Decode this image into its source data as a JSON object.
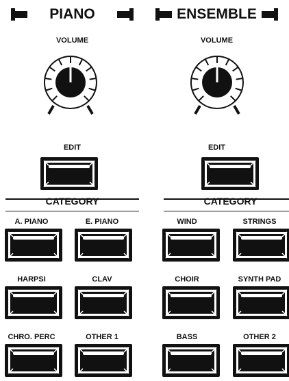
{
  "left": {
    "title": "PIANO",
    "volume_label": "VOLUME",
    "edit_label": "EDIT",
    "category_label": "CATEGORY",
    "buttons": [
      "A. PIANO",
      "E. PIANO",
      "HARPSI",
      "CLAV",
      "CHRO. PERC",
      "OTHER 1"
    ]
  },
  "right": {
    "title": "ENSEMBLE",
    "volume_label": "VOLUME",
    "edit_label": "EDIT",
    "category_label": "CATEGORY",
    "buttons": [
      "WIND",
      "STRINGS",
      "CHOIR",
      "SYNTH PAD",
      "BASS",
      "OTHER 2"
    ]
  },
  "colors": {
    "ink": "#111111",
    "background": "#ffffff"
  },
  "icons": {
    "knob": "volume-knob-icon",
    "button": "push-button-icon"
  }
}
